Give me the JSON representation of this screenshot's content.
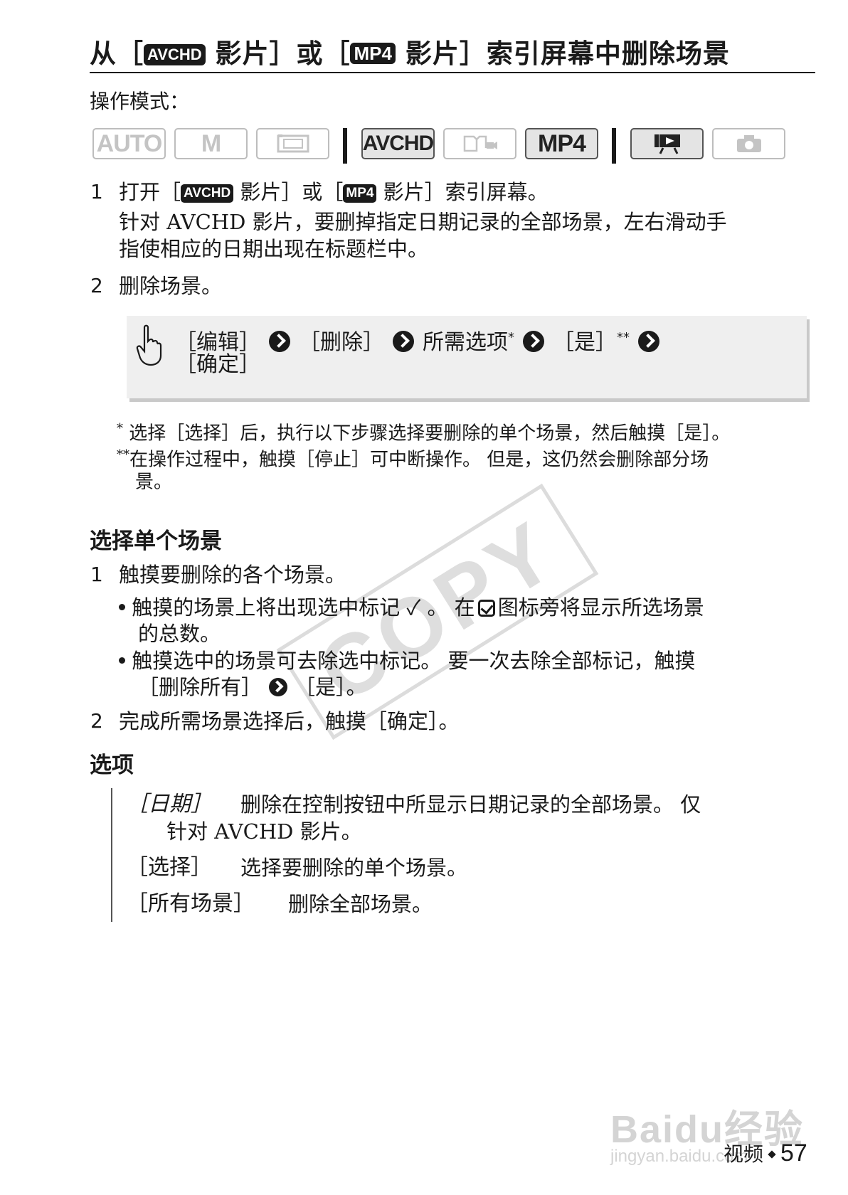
{
  "title": {
    "part1": "从［",
    "badge1": "AVCHD",
    "part2": " 影片］或［",
    "badge2": "MP4",
    "part3": " 影片］索引屏幕中删除场景"
  },
  "op_mode_label": "操作模式：",
  "modes": [
    {
      "label": "AUTO",
      "active": false
    },
    {
      "label": "M",
      "active": false
    },
    {
      "label": "film-icon",
      "active": false
    },
    {
      "label": "AVCHD",
      "active": true
    },
    {
      "label": "photo-movie-icon",
      "active": false
    },
    {
      "label": "MP4",
      "active": true
    },
    {
      "label": "playback-icon",
      "active": true
    },
    {
      "label": "camera-icon",
      "active": false
    }
  ],
  "step1": {
    "num": "1",
    "part1": "打开［",
    "badge1": "AVCHD",
    "part2": " 影片］或［",
    "badge2": "MP4",
    "part3": " 影片］索引屏幕。",
    "desc_line1": "针对 AVCHD 影片，要删掉指定日期记录的全部场景，左右滑动手",
    "desc_line2": "指使相应的日期出现在标题栏中。"
  },
  "step2": {
    "num": "2",
    "text": "删除场景。"
  },
  "instruction": {
    "item1": "［编辑］",
    "item2": "［删除］",
    "item3": "所需选项",
    "item3_sup": "*",
    "item4": "［是］",
    "item4_sup": "**",
    "item5": "［确定］"
  },
  "footnotes": {
    "fn1_mark": "*",
    "fn1": "选择［选择］后，执行以下步骤选择要删除的单个场景，然后触摸［是］。",
    "fn2_mark": "**",
    "fn2_line1": "在操作过程中，触摸［停止］可中断操作。 但是，这仍然会删除部分场",
    "fn2_line2": "景。"
  },
  "section_select": {
    "heading": "选择单个场景",
    "step1_num": "1",
    "step1_text": "触摸要删除的各个场景。",
    "bullet1_part1": "触摸的场景上将出现选中标记 ✓ 。 在",
    "bullet1_part2": "图标旁将显示所选场景",
    "bullet1_line2": "的总数。",
    "bullet2_line1": "触摸选中的场景可去除选中标记。 要一次去除全部标记，触摸",
    "bullet2_part1": "［删除所有］",
    "bullet2_part2": "［是］。",
    "step2_num": "2",
    "step2_text": "完成所需场景选择后，触摸［确定］。"
  },
  "section_options": {
    "heading": "选项",
    "opt1_key": "［日期］",
    "opt1_desc_line1": "删除在控制按钮中所显示日期记录的全部场景。 仅",
    "opt1_desc_line2": "针对 AVCHD 影片。",
    "opt2_key": "［选择］",
    "opt2_desc": "选择要删除的单个场景。",
    "opt3_key": "［所有场景］",
    "opt3_desc": "删除全部场景。"
  },
  "watermark_copy": "COPY",
  "watermark_baidu": "Baidu经验",
  "watermark_baidu_sub": "jingyan.baidu.com",
  "footer": {
    "section": "视频",
    "page": "57"
  }
}
